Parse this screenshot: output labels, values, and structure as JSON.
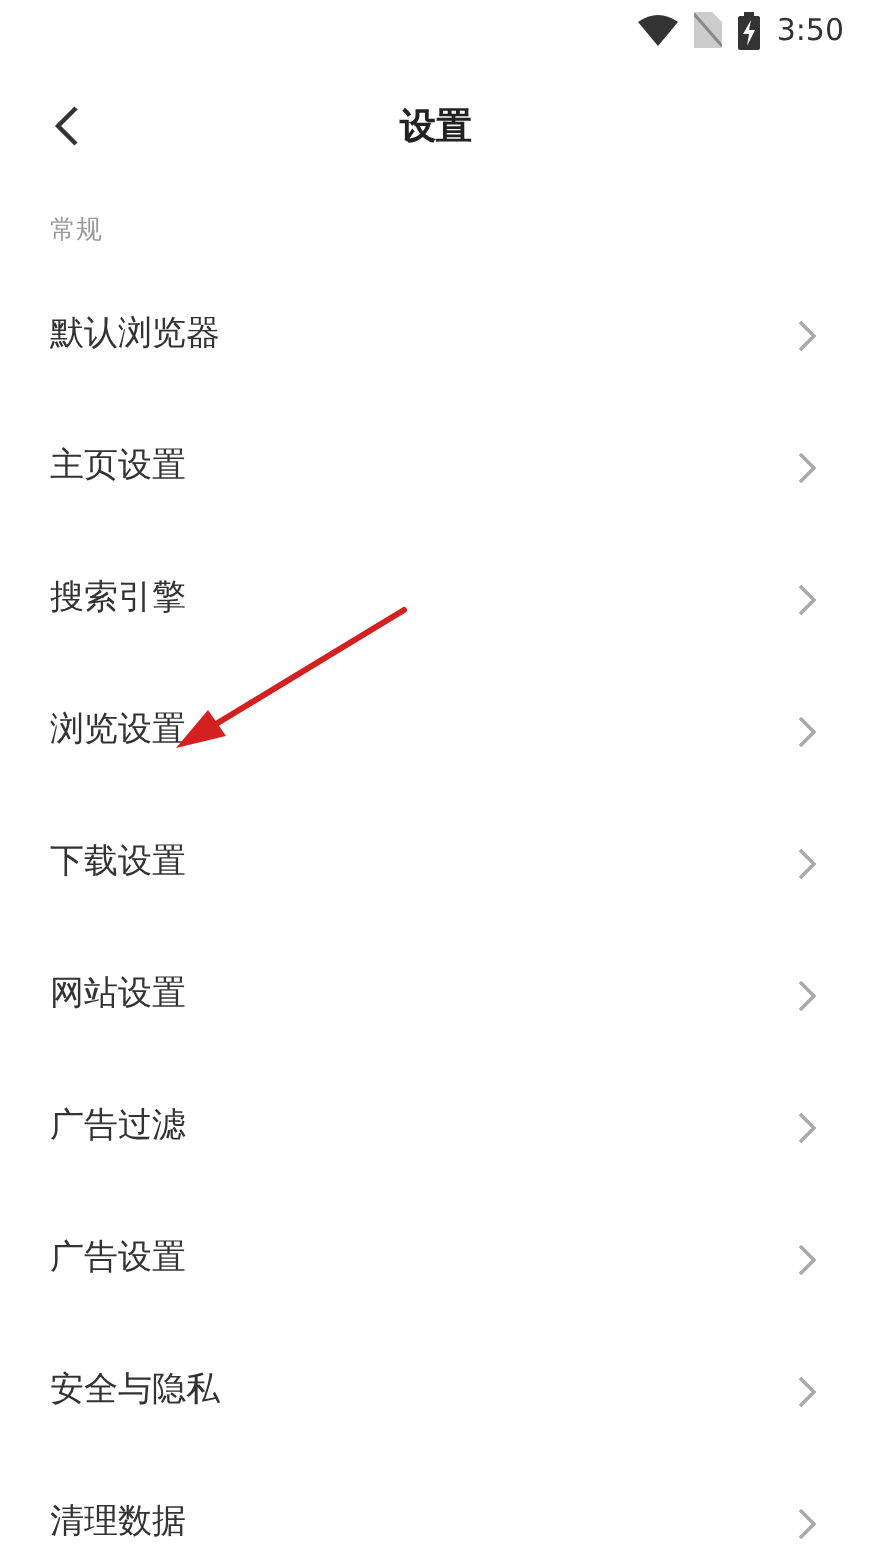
{
  "status_bar": {
    "time": "3:50"
  },
  "header": {
    "title": "设置"
  },
  "section": {
    "title": "常规"
  },
  "items": [
    {
      "label": "默认浏览器"
    },
    {
      "label": "主页设置"
    },
    {
      "label": "搜索引擎"
    },
    {
      "label": "浏览设置"
    },
    {
      "label": "下载设置"
    },
    {
      "label": "网站设置"
    },
    {
      "label": "广告过滤"
    },
    {
      "label": "广告设置"
    },
    {
      "label": "安全与隐私"
    },
    {
      "label": "清理数据"
    }
  ]
}
